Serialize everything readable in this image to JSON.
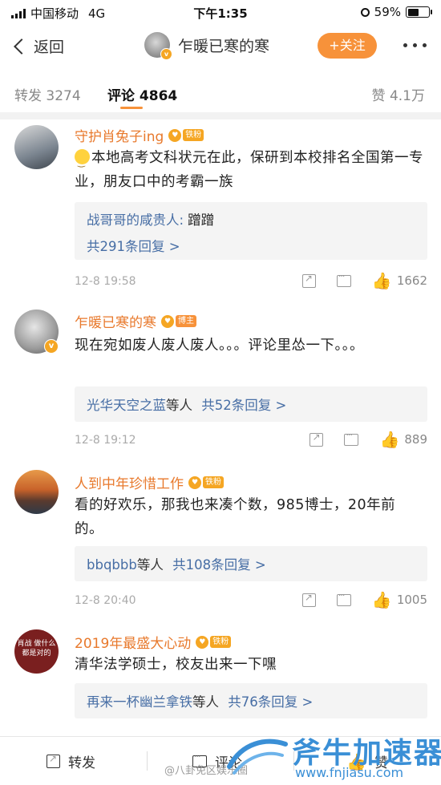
{
  "status_bar": {
    "carrier": "中国移动",
    "network": "4G",
    "time": "下午1:35",
    "battery": "59%",
    "battery_level": 0.59
  },
  "nav": {
    "back_label": "返回",
    "user_name": "乍暖已寒的寒",
    "follow_label": "+关注"
  },
  "tabs": {
    "repost": "转发 3274",
    "comments": "评论 4864",
    "likes": "赞 4.1万"
  },
  "colors": {
    "accent": "#f7923a",
    "name": "#e8792c",
    "link": "#476ea5"
  },
  "comments": [
    {
      "name": "守护肖兔子ing",
      "badge": "铁粉",
      "text": "本地高考文科状元在此，保研到本校排名全国第一专业，朋友口中的考霸一族",
      "reply_line1_name": "战哥哥的咸贵人:",
      "reply_line1_text": " 蹭蹭",
      "reply_line2": "共291条回复 >",
      "date": "12-8 19:58",
      "likes": "1662"
    },
    {
      "name": "乍暖已寒的寒",
      "badge": "博主",
      "text": "现在宛如废人废人废人。。。评论里怂一下。。。",
      "reply_names": "光华天空之蓝",
      "reply_mid": "等人",
      "reply_count": "共52条回复 >",
      "date": "12-8 19:12",
      "likes": "889"
    },
    {
      "name": "人到中年珍惜工作",
      "badge": "铁粉",
      "text": "看的好欢乐，那我也来凑个数，985博士，20年前的。",
      "reply_names": "bbqbbb",
      "reply_mid": "等人",
      "reply_count": "共108条回复 >",
      "date": "12-8 20:40",
      "likes": "1005"
    },
    {
      "name": "2019年最盛大心动",
      "badge": "铁粉",
      "avatar_text": "肖战 做什么 都是对的",
      "text": "清华法学硕士，校友出来一下嘿",
      "reply_names": "再来一杯幽兰拿铁",
      "reply_mid": "等人",
      "reply_count": "共76条回复 >"
    }
  ],
  "bottom_bar": {
    "repost": "转发",
    "comment": "评论",
    "like": "赞"
  },
  "watermark": "@八卦免区娱乐圈",
  "brand": {
    "name": "斧牛加速器",
    "url": "www.fnjiasu.com"
  }
}
